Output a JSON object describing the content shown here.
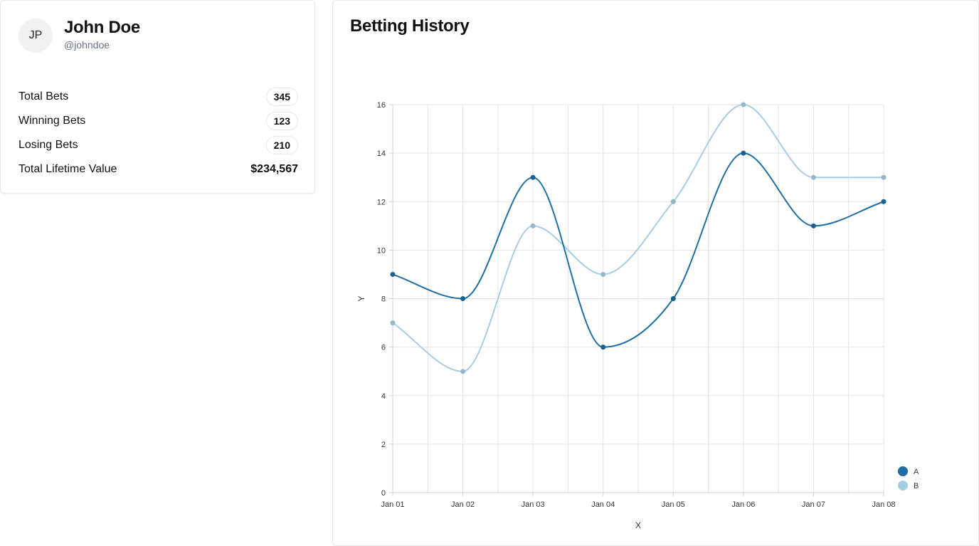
{
  "profile": {
    "initials": "JP",
    "name": "John Doe",
    "handle": "@johndoe",
    "stats": [
      {
        "label": "Total Bets",
        "value": "345"
      },
      {
        "label": "Winning Bets",
        "value": "123"
      },
      {
        "label": "Losing Bets",
        "value": "210"
      }
    ],
    "lifetime_label": "Total Lifetime Value",
    "lifetime_value": "$234,567"
  },
  "history": {
    "title": "Betting History"
  },
  "chart_data": {
    "type": "line",
    "curve": "smooth",
    "x": [
      "Jan 01",
      "Jan 02",
      "Jan 03",
      "Jan 04",
      "Jan 05",
      "Jan 06",
      "Jan 07",
      "Jan 08"
    ],
    "series": [
      {
        "name": "A",
        "color": "#1f6fa3",
        "values": [
          9,
          8,
          13,
          6,
          8,
          14,
          11,
          12
        ]
      },
      {
        "name": "B",
        "color": "#a6cde2",
        "values": [
          7,
          5,
          11,
          9,
          12,
          16,
          13,
          13
        ]
      }
    ],
    "xlabel": "X",
    "ylabel": "Y",
    "ylim": [
      0,
      16
    ],
    "yticks": [
      0,
      2,
      4,
      6,
      8,
      10,
      12,
      14,
      16
    ],
    "grid": true,
    "legend": "bottom-right"
  }
}
